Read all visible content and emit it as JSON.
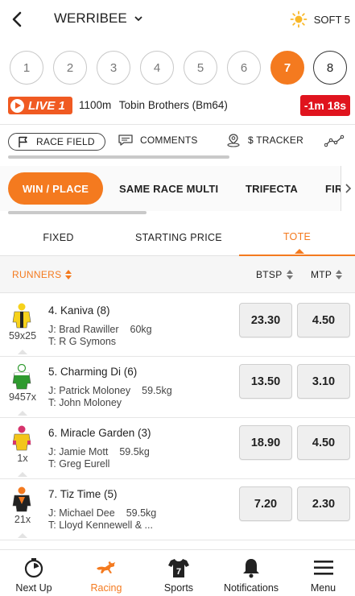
{
  "header": {
    "venue": "WERRIBEE",
    "weather_icon": "sun-icon",
    "track_condition": "SOFT 5"
  },
  "races": [
    {
      "number": "1"
    },
    {
      "number": "2"
    },
    {
      "number": "3"
    },
    {
      "number": "4"
    },
    {
      "number": "5"
    },
    {
      "number": "6"
    },
    {
      "number": "7",
      "selected": true
    },
    {
      "number": "8"
    }
  ],
  "race": {
    "live_label": "LIVE 1",
    "distance": "1100m",
    "name": "Tobin Brothers (Bm64)",
    "countdown": "-1m 18s"
  },
  "subnav": {
    "race_field": "RACE FIELD",
    "comments": "COMMENTS",
    "tracker": "$ TRACKER"
  },
  "bet_types": [
    "WIN / PLACE",
    "SAME RACE MULTI",
    "TRIFECTA",
    "FIR"
  ],
  "price_tabs": [
    "FIXED",
    "STARTING PRICE",
    "TOTE"
  ],
  "active_price_tab": "TOTE",
  "runners_header": {
    "runners": "RUNNERS",
    "col1": "BTSP",
    "col2": "MTP"
  },
  "runners": [
    {
      "title": "4. Kaniva (8)",
      "jockey": "J: Brad Rawiller",
      "weight": "60kg",
      "trainer": "T: R G Symons",
      "form": "59x25",
      "btsp": "23.30",
      "mtp": "4.50",
      "silk_colors": [
        "#f6d21c",
        "#222222"
      ]
    },
    {
      "title": "5. Charming Di (6)",
      "jockey": "J: Patrick Moloney",
      "weight": "59.5kg",
      "trainer": "T: John Moloney",
      "form": "9457x",
      "btsp": "13.50",
      "mtp": "3.10",
      "silk_colors": [
        "#2f9a2f",
        "#ffffff"
      ]
    },
    {
      "title": "6. Miracle Garden (3)",
      "jockey": "J: Jamie Mott",
      "weight": "59.5kg",
      "trainer": "T: Greg Eurell",
      "form": "1x",
      "btsp": "18.90",
      "mtp": "4.50",
      "silk_colors": [
        "#f3c51a",
        "#d6336c"
      ]
    },
    {
      "title": "7. Tiz Time (5)",
      "jockey": "J: Michael Dee",
      "weight": "59.5kg",
      "trainer": "T: Lloyd Kennewell & ...",
      "form": "21x",
      "btsp": "7.20",
      "mtp": "2.30",
      "silk_colors": [
        "#222222",
        "#f47a1f"
      ]
    }
  ],
  "bottom_nav": [
    {
      "label": "Next Up",
      "icon": "stopwatch-icon"
    },
    {
      "label": "Racing",
      "icon": "horse-icon",
      "active": true
    },
    {
      "label": "Sports",
      "icon": "jersey-icon"
    },
    {
      "label": "Notifications",
      "icon": "bell-icon"
    },
    {
      "label": "Menu",
      "icon": "hamburger-icon"
    }
  ],
  "colors": {
    "accent": "#f47a1f",
    "live": "#f05a22",
    "countdown": "#e0141e"
  }
}
